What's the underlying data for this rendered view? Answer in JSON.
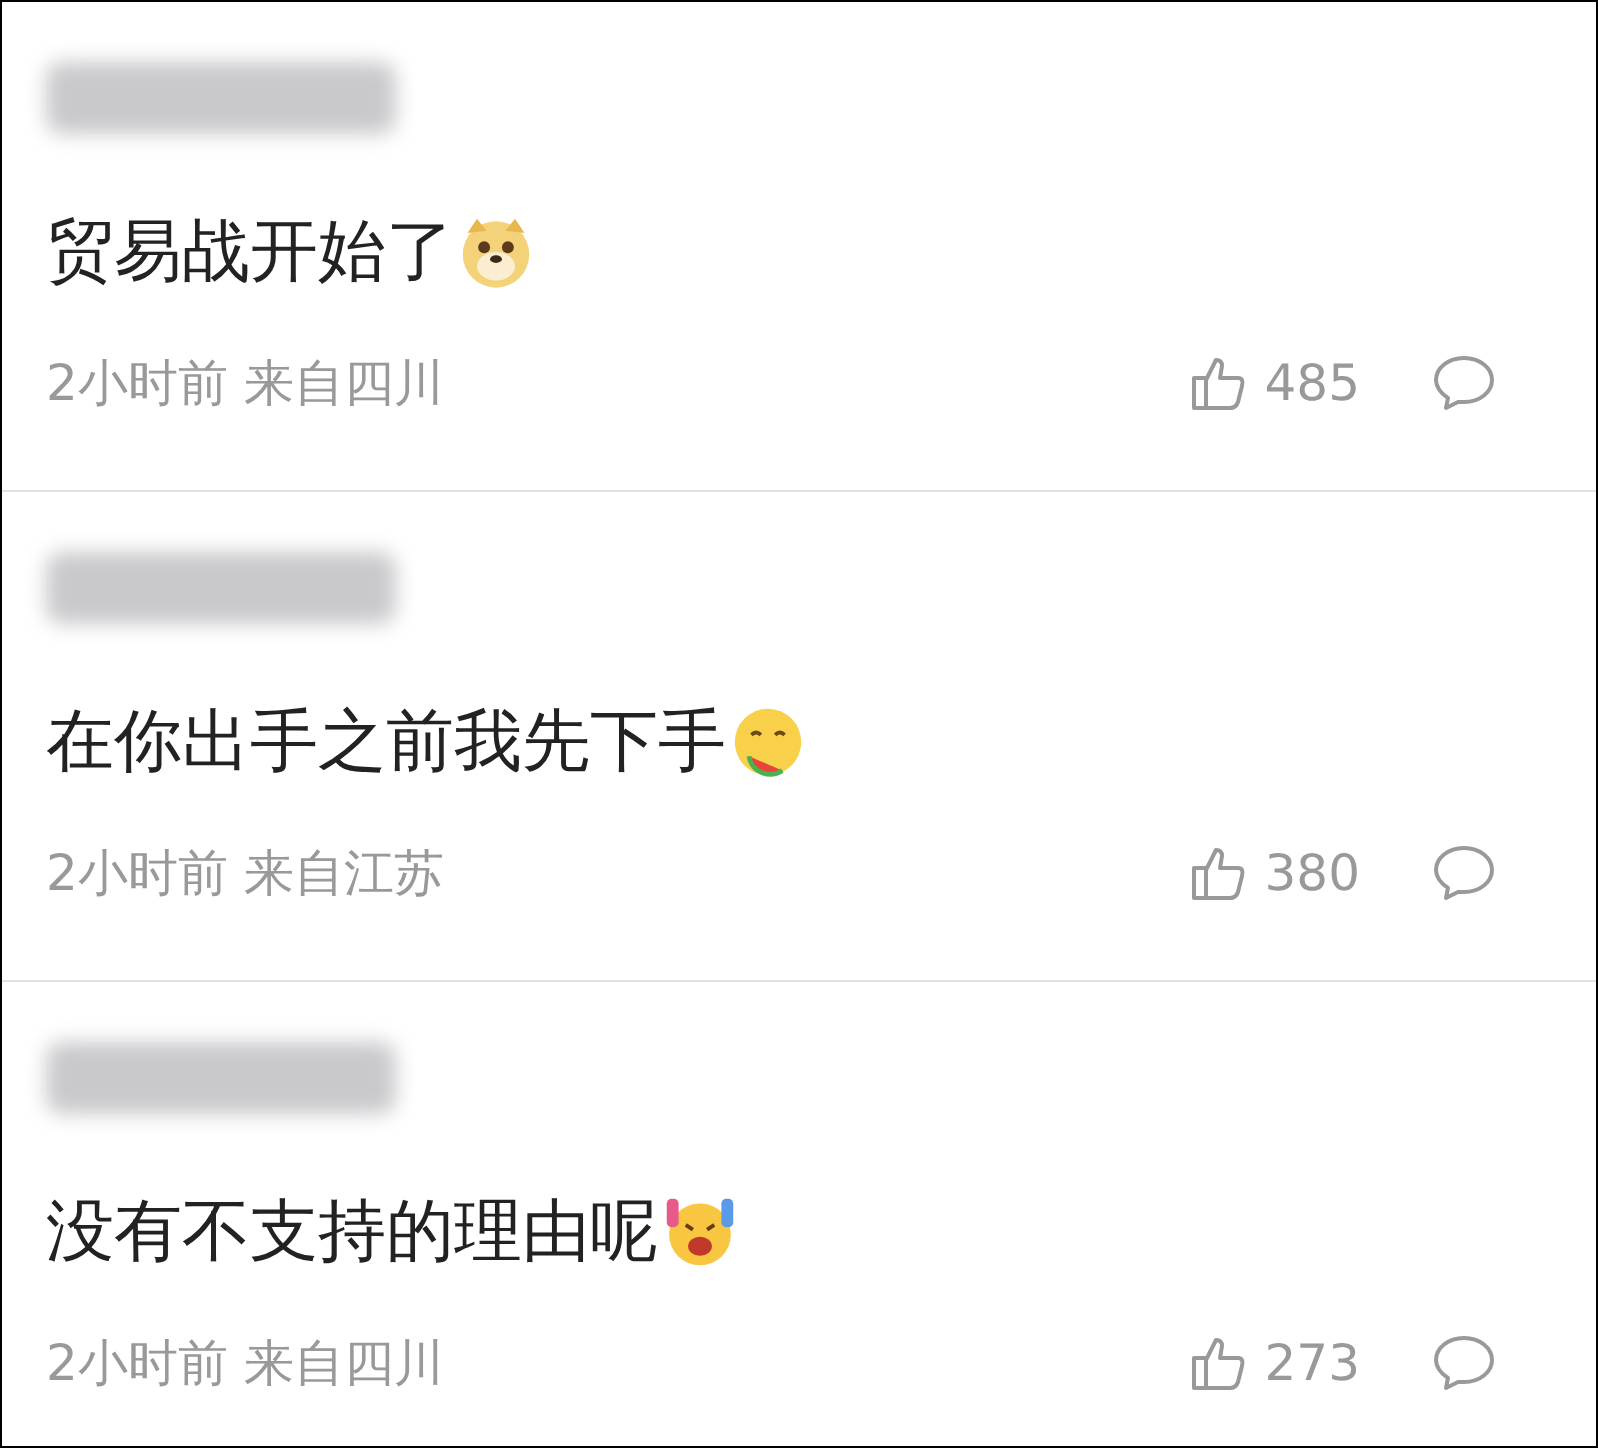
{
  "comments": [
    {
      "text": "贸易战开始了",
      "emoji": {
        "kind": "dog"
      },
      "time": "2小时前",
      "location": "来自四川",
      "likes": "485"
    },
    {
      "text": "在你出手之前我先下手",
      "emoji": {
        "kind": "eating"
      },
      "time": "2小时前",
      "location": "来自江苏",
      "likes": "380"
    },
    {
      "text": "没有不支持的理由呢",
      "emoji": {
        "kind": "cheer"
      },
      "time": "2小时前",
      "location": "来自四川",
      "likes": "273"
    }
  ]
}
